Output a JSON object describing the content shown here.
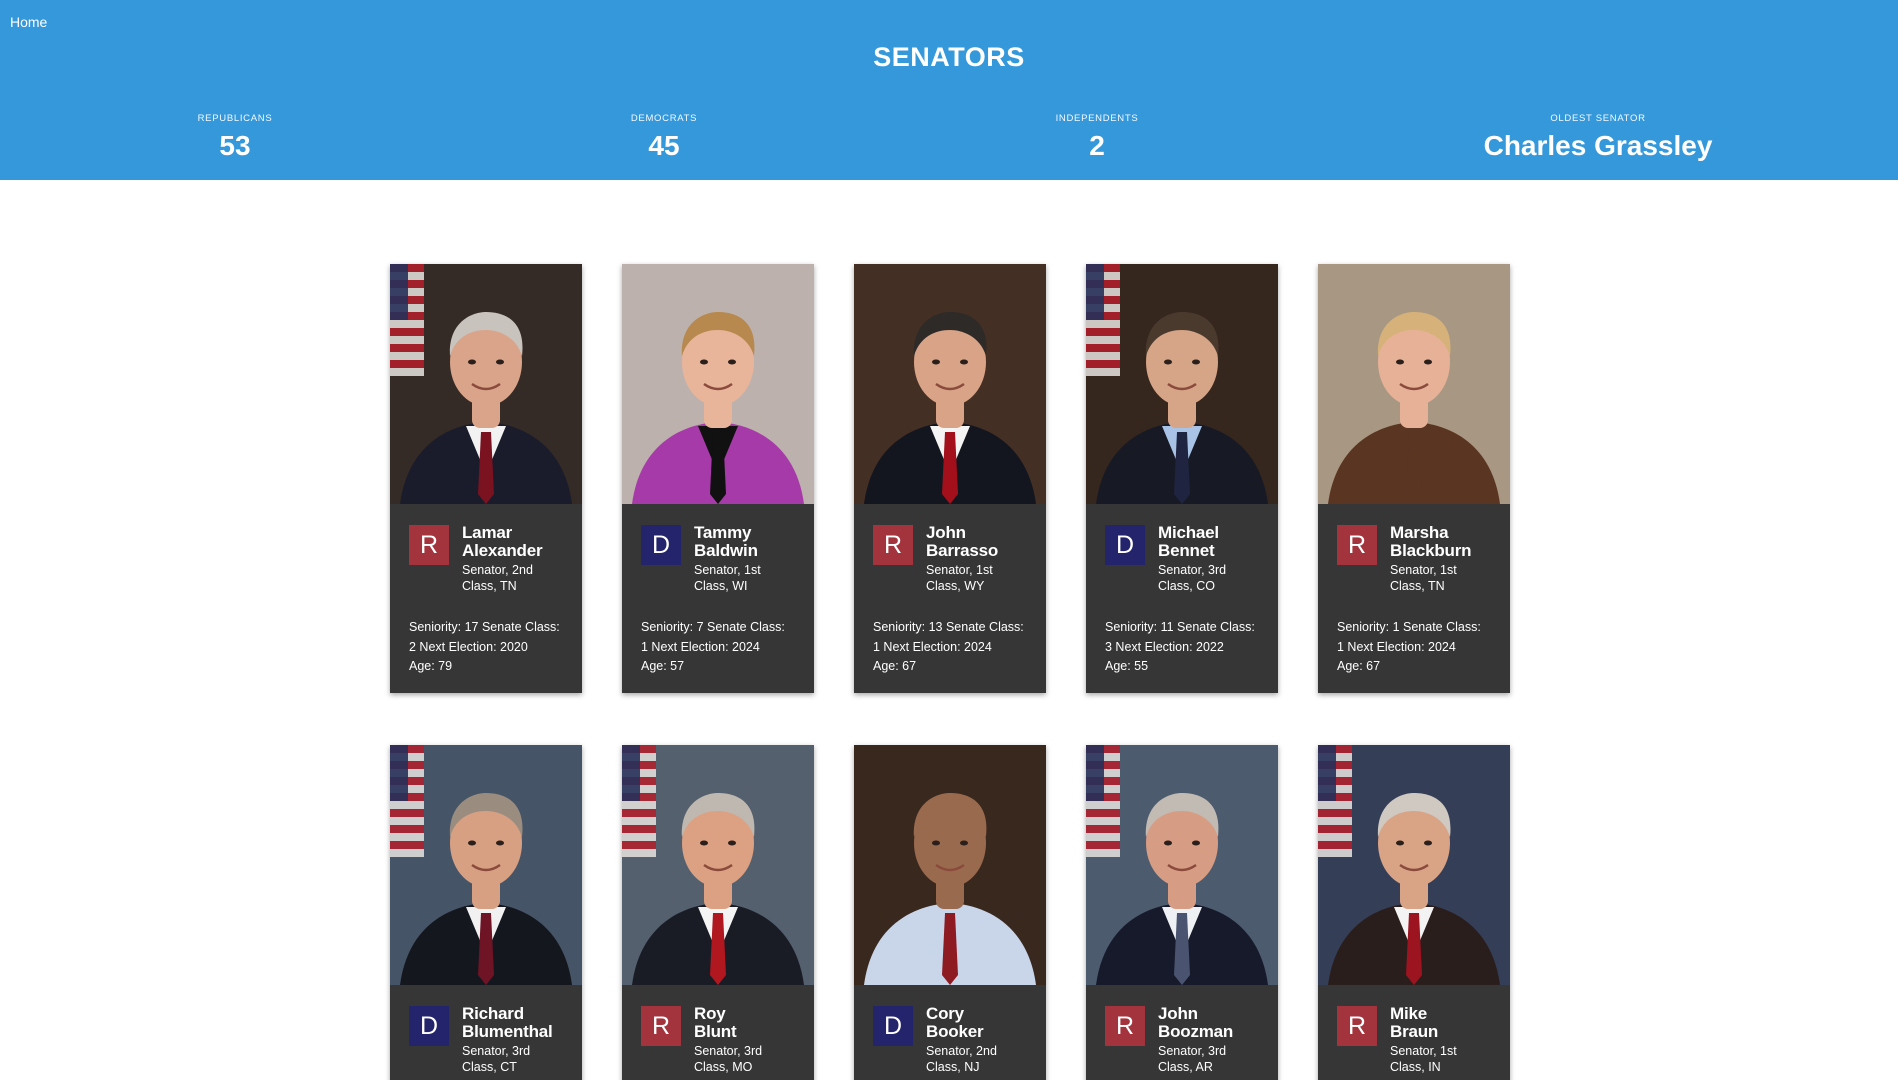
{
  "nav": {
    "home_label": "Home"
  },
  "header": {
    "title": "SENATORS",
    "stats": [
      {
        "label": "REPUBLICANS",
        "value": "53"
      },
      {
        "label": "DEMOCRATS",
        "value": "45"
      },
      {
        "label": "INDEPENDENTS",
        "value": "2"
      },
      {
        "label": "OLDEST SENATOR",
        "value": "Charles Grassley"
      }
    ]
  },
  "colors": {
    "header_bg": "#3498db",
    "republican": "#a3343d",
    "democrat": "#23246b",
    "card_bg": "#363636"
  },
  "senators": [
    {
      "party": "R",
      "first": "Lamar",
      "last": "Alexander",
      "desc_line1": "Senator, 2nd",
      "desc_line2": "Class, TN",
      "details_line1": "Seniority: 17 Senate Class:",
      "details_line2": "2 Next Election: 2020",
      "details_line3": "Age: 79",
      "photo_bg": "#3a2f2a",
      "photo_suit": "#1a1c2c",
      "photo_skin": "#d9a48a",
      "photo_hair": "#c9c3bd",
      "photo_tie": "#7a1220",
      "photo_shirt": "#f2f2f2",
      "photo_flag": true
    },
    {
      "party": "D",
      "first": "Tammy",
      "last": "Baldwin",
      "desc_line1": "Senator, 1st",
      "desc_line2": "Class, WI",
      "details_line1": "Seniority: 7 Senate Class:",
      "details_line2": "1 Next Election: 2024",
      "details_line3": "Age: 57",
      "photo_bg": "#cfc3bd",
      "photo_suit": "#a63aa8",
      "photo_skin": "#e8b59b",
      "photo_hair": "#b8894f",
      "photo_tie": "#111111",
      "photo_shirt": "#111111",
      "photo_flag": false
    },
    {
      "party": "R",
      "first": "John",
      "last": "Barrasso",
      "desc_line1": "Senator, 1st",
      "desc_line2": "Class, WY",
      "details_line1": "Seniority: 13 Senate Class:",
      "details_line2": "1 Next Election: 2024",
      "details_line3": "Age: 67",
      "photo_bg": "#4a3428",
      "photo_suit": "#14161f",
      "photo_skin": "#d8a386",
      "photo_hair": "#2e2a28",
      "photo_tie": "#a3101c",
      "photo_shirt": "#f4f4f4",
      "photo_flag": false
    },
    {
      "party": "D",
      "first": "Michael",
      "last": "Bennet",
      "desc_line1": "Senator, 3rd",
      "desc_line2": "Class, CO",
      "details_line1": "Seniority: 11 Senate Class:",
      "details_line2": "3 Next Election: 2022",
      "details_line3": "Age: 55",
      "photo_bg": "#3b2a22",
      "photo_suit": "#171a24",
      "photo_skin": "#d6a487",
      "photo_hair": "#4a3a2e",
      "photo_tie": "#1f2540",
      "photo_shirt": "#a9c3e6",
      "photo_flag": true
    },
    {
      "party": "R",
      "first": "Marsha",
      "last": "Blackburn",
      "desc_line1": "Senator, 1st",
      "desc_line2": "Class, TN",
      "details_line1": "Seniority: 1 Senate Class:",
      "details_line2": "1 Next Election: 2024",
      "details_line3": "Age: 67",
      "photo_bg": "#b9a68f",
      "photo_suit": "#5a3522",
      "photo_skin": "#e6b197",
      "photo_hair": "#d6b27a",
      "photo_tie": "#5a3522",
      "photo_shirt": "#5a3522",
      "photo_flag": false
    },
    {
      "party": "D",
      "first": "Richard",
      "last": "Blumenthal",
      "desc_line1": "Senator, 3rd",
      "desc_line2": "Class, CT",
      "details_line1": "",
      "details_line2": "",
      "details_line3": "",
      "photo_bg": "#4e5d72",
      "photo_suit": "#15171f",
      "photo_skin": "#d7a083",
      "photo_hair": "#9a8d80",
      "photo_tie": "#6e1425",
      "photo_shirt": "#f1f1f1",
      "photo_flag": true
    },
    {
      "party": "R",
      "first": "Roy",
      "last": "Blunt",
      "desc_line1": "Senator, 3rd",
      "desc_line2": "Class, MO",
      "details_line1": "",
      "details_line2": "",
      "details_line3": "",
      "photo_bg": "#5d6a79",
      "photo_suit": "#1a1c25",
      "photo_skin": "#dca182",
      "photo_hair": "#bfb8b0",
      "photo_tie": "#b0171f",
      "photo_shirt": "#f4f4f4",
      "photo_flag": true
    },
    {
      "party": "D",
      "first": "Cory",
      "last": "Booker",
      "desc_line1": "Senator, 2nd",
      "desc_line2": "Class, NJ",
      "details_line1": "",
      "details_line2": "",
      "details_line3": "",
      "photo_bg": "#3f2c21",
      "photo_suit": "#c9d6ea",
      "photo_skin": "#9a6a4f",
      "photo_hair": "#9a6a4f",
      "photo_tie": "#8e1a22",
      "photo_shirt": "#c9d6ea",
      "photo_flag": false
    },
    {
      "party": "R",
      "first": "John",
      "last": "Boozman",
      "desc_line1": "Senator, 3rd",
      "desc_line2": "Class, AR",
      "details_line1": "",
      "details_line2": "",
      "details_line3": "",
      "photo_bg": "#55657a",
      "photo_suit": "#161a2a",
      "photo_skin": "#d69d84",
      "photo_hair": "#c2bbb4",
      "photo_tie": "#4a5470",
      "photo_shirt": "#eef0f4",
      "photo_flag": true
    },
    {
      "party": "R",
      "first": "Mike",
      "last": "Braun",
      "desc_line1": "Senator, 1st",
      "desc_line2": "Class, IN",
      "details_line1": "",
      "details_line2": "",
      "details_line3": "",
      "photo_bg": "#3b4560",
      "photo_suit": "#2a1e1c",
      "photo_skin": "#d9a386",
      "photo_hair": "#cfc9c2",
      "photo_tie": "#9c1420",
      "photo_shirt": "#f3f3f3",
      "photo_flag": true
    }
  ]
}
